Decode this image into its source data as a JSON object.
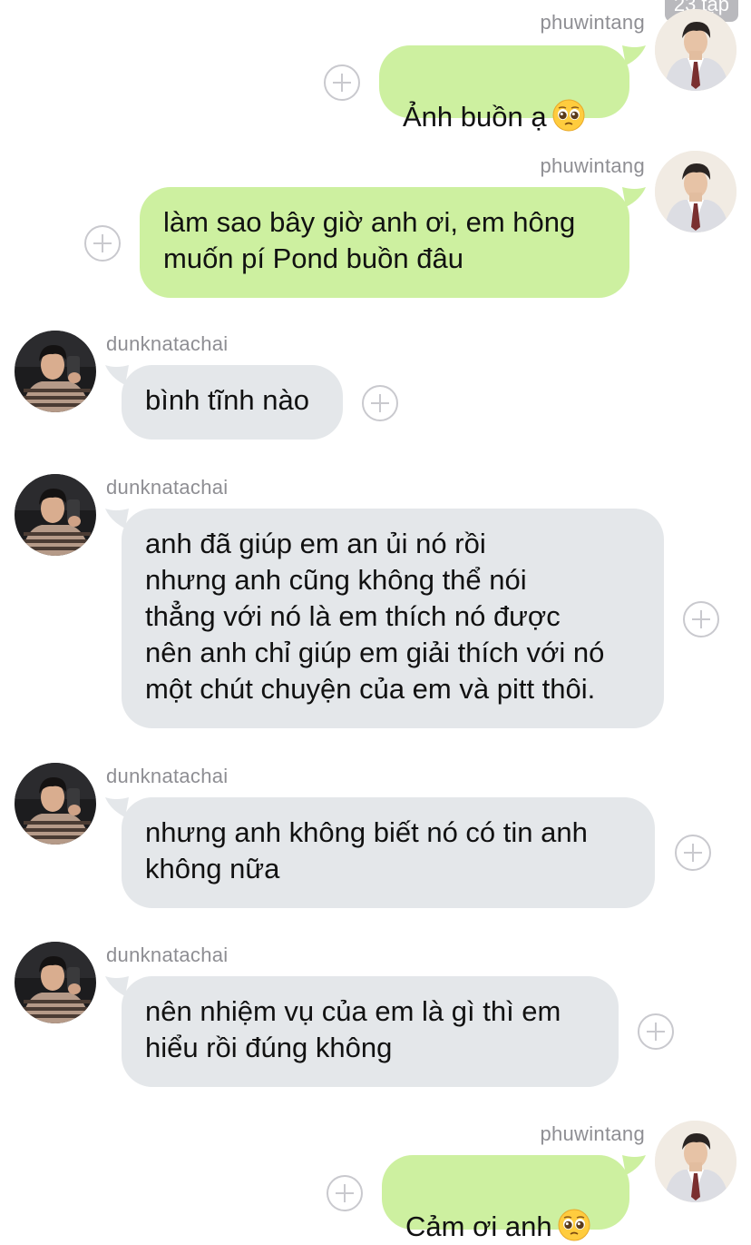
{
  "header": {
    "time_badge": "23 tạp"
  },
  "contacts": {
    "me": {
      "username": "phuwintang"
    },
    "other": {
      "username": "dunknatachai"
    }
  },
  "icons": {
    "attach": "plus-circle-icon",
    "emoji": "pleading-face-emoji"
  },
  "colors": {
    "outgoing_bubble": "#cdf0a0",
    "incoming_bubble": "#e4e7ea",
    "username": "#8e8e93"
  },
  "messages": [
    {
      "sender": "phuwintang",
      "direction": "outgoing",
      "text": "Ảnh buồn ạ",
      "emoji": "🥺"
    },
    {
      "sender": "phuwintang",
      "direction": "outgoing",
      "text": "làm sao bây giờ anh ơi, em hông\nmuốn pí Pond buồn đâu"
    },
    {
      "sender": "dunknatachai",
      "direction": "incoming",
      "text": "bình tĩnh nào"
    },
    {
      "sender": "dunknatachai",
      "direction": "incoming",
      "text": "anh đã giúp em an ủi nó rồi\nnhưng anh cũng không thể nói\nthẳng với nó là em thích nó được\nnên anh chỉ giúp em giải thích với nó\nmột chút chuyện của em và pitt thôi."
    },
    {
      "sender": "dunknatachai",
      "direction": "incoming",
      "text": "nhưng anh không biết nó có tin anh\nkhông nữa"
    },
    {
      "sender": "dunknatachai",
      "direction": "incoming",
      "text": "nên nhiệm vụ của em là gì thì em\nhiểu rồi đúng không"
    },
    {
      "sender": "phuwintang",
      "direction": "outgoing",
      "text": "Cảm ơi anh",
      "emoji": "🥺"
    }
  ]
}
